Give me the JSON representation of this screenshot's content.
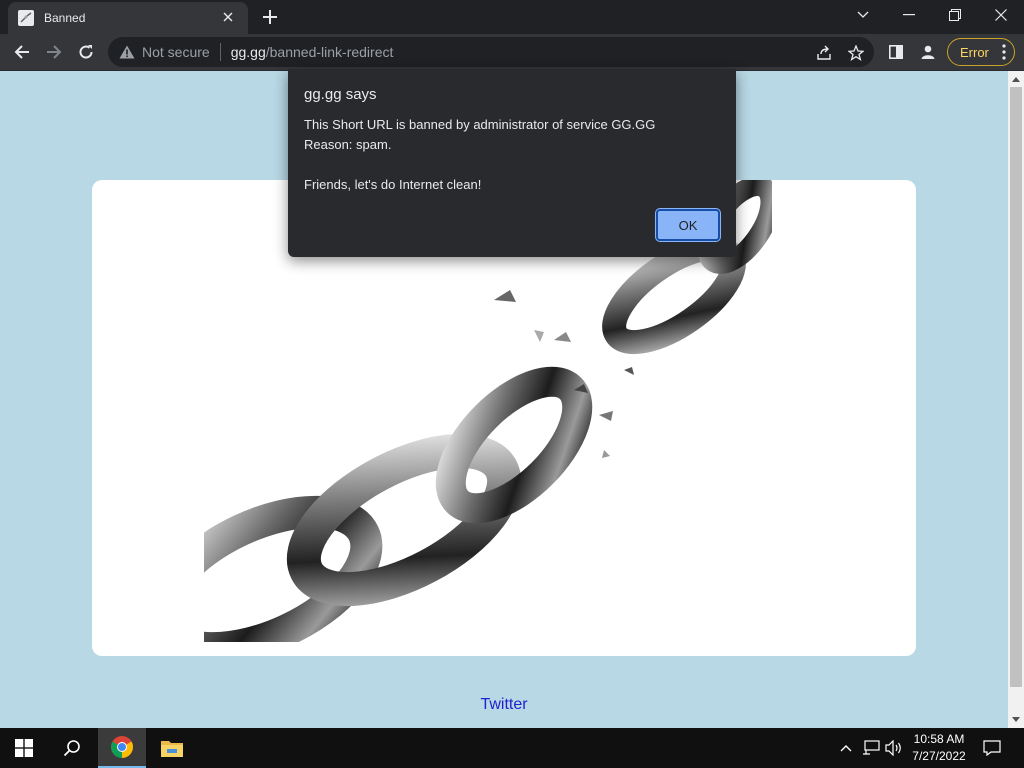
{
  "browser": {
    "tab": {
      "title": "Banned"
    },
    "address": {
      "security_label": "Not secure",
      "host": "gg.gg",
      "path": "/banned-link-redirect"
    },
    "profile_status": "Error"
  },
  "page": {
    "twitter_link": "Twitter"
  },
  "dialog": {
    "title": "gg.gg says",
    "message": "This Short URL is banned by administrator of service GG.GG\nReason: spam.\n\nFriends, let's do Internet clean!",
    "ok_label": "OK"
  },
  "taskbar": {
    "time": "10:58 AM",
    "date": "7/27/2022"
  },
  "colors": {
    "page_background": "#b8d8e6",
    "dialog_button": "#8ab4f8",
    "error_pill": "#fdd663",
    "link": "#2222cc"
  },
  "icons": [
    "favicon-icon",
    "close-icon",
    "plus-icon",
    "chevron-down-icon",
    "minimize-icon",
    "restore-icon",
    "window-close-icon",
    "back-icon",
    "forward-icon",
    "reload-icon",
    "warning-icon",
    "share-icon",
    "star-icon",
    "side-panel-icon",
    "profile-icon",
    "more-icon",
    "broken-chain-image",
    "windows-start-icon",
    "search-icon",
    "chrome-icon",
    "file-explorer-icon",
    "chevron-up-icon",
    "network-icon",
    "volume-icon",
    "notification-icon"
  ]
}
